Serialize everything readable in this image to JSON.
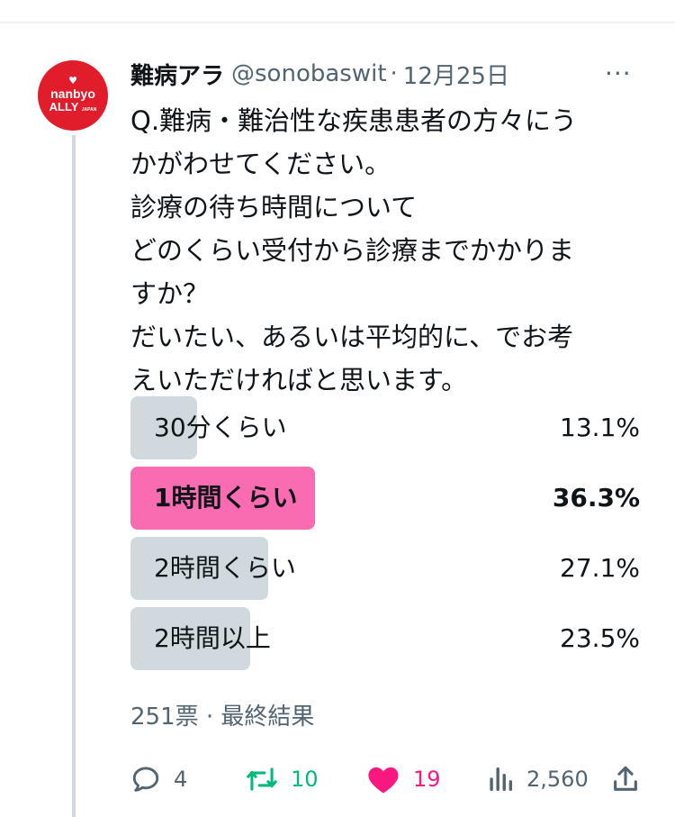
{
  "tweet": {
    "display_name": "難病アラ",
    "handle": "@sonobaswit",
    "separator": "·",
    "date": "12月25日",
    "more_label": "···",
    "avatar": {
      "line1": "nanbyo",
      "line2": "ALLY",
      "line2_small": "JAPAN"
    },
    "text_lines": [
      "Q.難病・難治性な疾患患者の方々にう",
      "かがわせてください。",
      "診療の待ち時間について",
      "どのくらい受付から診療までかかりま",
      "すか？",
      "だいたい、あるいは平均的に、でお考",
      "えいただければと思います。"
    ]
  },
  "poll": {
    "options": [
      {
        "label": "30分くらい",
        "percent_text": "13.1%",
        "percent": 13.1,
        "winner": false
      },
      {
        "label": "1時間くらい",
        "percent_text": "36.3%",
        "percent": 36.3,
        "winner": true
      },
      {
        "label": "2時間くらい",
        "percent_text": "27.1%",
        "percent": 27.1,
        "winner": false
      },
      {
        "label": "2時間以上",
        "percent_text": "23.5%",
        "percent": 23.5,
        "winner": false
      }
    ],
    "meta": "251票 · 最終結果"
  },
  "actions": {
    "reply_count": "4",
    "retweet_count": "10",
    "like_count": "19",
    "views_count": "2,560"
  },
  "colors": {
    "winner_bar": "#f96cb1",
    "bar": "#cfd9de",
    "retweet": "#00ba7c",
    "like": "#f91880",
    "muted": "#536471",
    "avatar_bg": "#e11d2b"
  },
  "icons": {
    "reply": "reply-icon",
    "retweet": "retweet-icon",
    "like": "heart-icon",
    "views": "views-icon",
    "share": "share-icon",
    "more": "more-icon"
  }
}
